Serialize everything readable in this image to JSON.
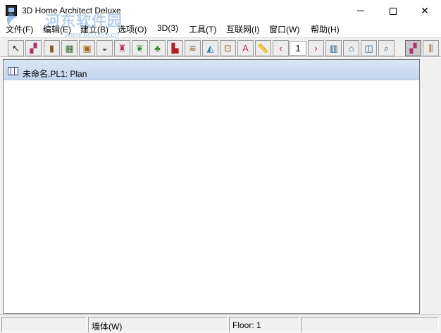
{
  "window": {
    "title": "3D Home Architect Deluxe"
  },
  "watermark": {
    "text": "河东软件园",
    "url": "www.pc0359.cn"
  },
  "menu": [
    {
      "label": "文件(F)"
    },
    {
      "label": "编辑(E)"
    },
    {
      "label": "建立(B)"
    },
    {
      "label": "选项(O)"
    },
    {
      "label": "3D(3)"
    },
    {
      "label": "工具(T)"
    },
    {
      "label": "互联网(I)"
    },
    {
      "label": "窗口(W)"
    },
    {
      "label": "帮助(H)"
    }
  ],
  "toolbar": {
    "floor_number": "1",
    "buttons": [
      {
        "icon": "select-arrow-icon",
        "glyph": "↖",
        "color": "#222222"
      },
      {
        "icon": "wall-icon",
        "glyph": "▞",
        "color": "#b0306e"
      },
      {
        "icon": "door-icon",
        "glyph": "▮",
        "color": "#8b5a2b"
      },
      {
        "icon": "window-icon",
        "glyph": "▦",
        "color": "#3a6a3a"
      },
      {
        "icon": "cabinet-icon",
        "glyph": "▣",
        "color": "#a06a20"
      },
      {
        "icon": "fixture-icon",
        "glyph": "◒",
        "color": "#555555"
      },
      {
        "icon": "furniture-chair-icon",
        "glyph": "♜",
        "color": "#b0306e"
      },
      {
        "icon": "landscape-shrub-icon",
        "glyph": "❦",
        "color": "#2f8a2f"
      },
      {
        "icon": "tree-icon",
        "glyph": "♣",
        "color": "#2f8a2f"
      },
      {
        "icon": "fireplace-icon",
        "glyph": "▙",
        "color": "#b02020"
      },
      {
        "icon": "stairs-icon",
        "glyph": "≋",
        "color": "#8b5a2b"
      },
      {
        "icon": "roof-icon",
        "glyph": "◭",
        "color": "#2a7ab0"
      },
      {
        "icon": "electrical-outlet-icon",
        "glyph": "⊡",
        "color": "#8b6a2b"
      },
      {
        "icon": "text-icon",
        "glyph": "A",
        "color": "#b0306e"
      },
      {
        "icon": "dimension-ruler-icon",
        "glyph": "📏",
        "color": "#b08a20"
      },
      {
        "icon": "floor-down-icon",
        "glyph": "‹",
        "color": "#c01818"
      },
      {
        "icon": "floor-up-icon",
        "glyph": "›",
        "color": "#c01818"
      },
      {
        "icon": "elevation-view-icon",
        "glyph": "▥",
        "color": "#1f5a8a"
      },
      {
        "icon": "3d-perspective-icon",
        "glyph": "⌂",
        "color": "#1f5a8a"
      },
      {
        "icon": "camera-view-icon",
        "glyph": "◫",
        "color": "#1f5a8a"
      },
      {
        "icon": "zoom-icon",
        "glyph": "⌕",
        "color": "#1f5a8a"
      },
      {
        "icon": "plan-view-icon",
        "glyph": "▞",
        "color": "#b0306e"
      },
      {
        "icon": "railing-icon",
        "glyph": "⫼",
        "color": "#8b5a2b"
      }
    ]
  },
  "document": {
    "title": "未命名.PL1: Plan"
  },
  "status": {
    "pane1": "",
    "pane2": "墙体(W)",
    "pane3": "Floor: 1",
    "pane4": ""
  },
  "colors": {
    "doc_title_bg": "#c4d6ec",
    "toolbar_bg": "#f0f0f0"
  }
}
